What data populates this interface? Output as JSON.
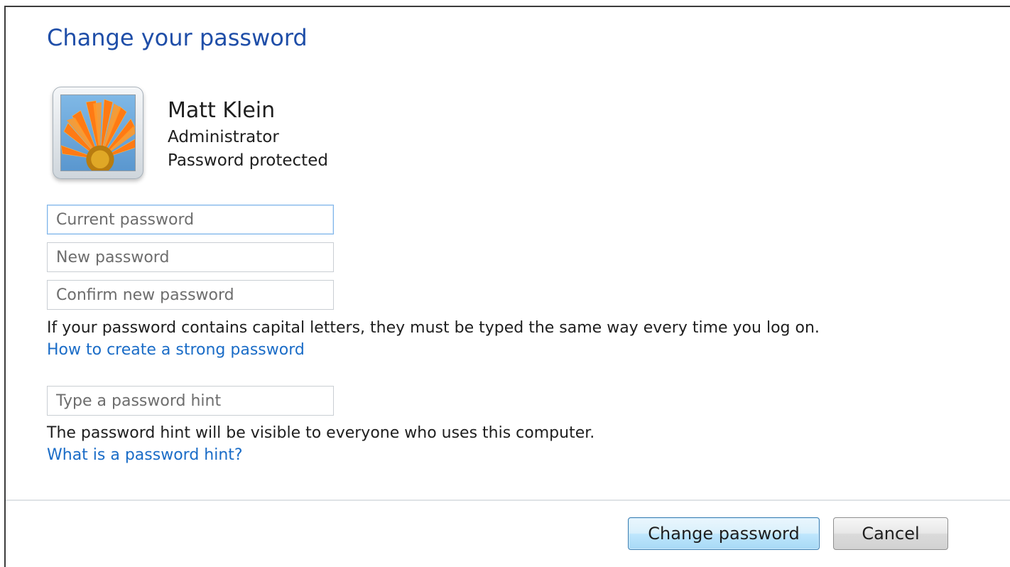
{
  "dialog": {
    "title": "Change your password"
  },
  "user": {
    "name": "Matt Klein",
    "role": "Administrator",
    "status": "Password protected",
    "avatar_icon": "flower-avatar-icon"
  },
  "fields": {
    "current_password_placeholder": "Current password",
    "new_password_placeholder": "New password",
    "confirm_password_placeholder": "Confirm new password",
    "hint_placeholder": "Type a password hint"
  },
  "notes": {
    "capitals_note": "If your password contains capital letters, they must be typed the same way every time you log on.",
    "strong_password_link": "How to create a strong password",
    "hint_visibility_note": "The password hint will be visible to everyone who uses this computer.",
    "hint_link": "What is a password hint?"
  },
  "buttons": {
    "change_label": "Change password",
    "cancel_label": "Cancel"
  },
  "colors": {
    "title": "#1f4ea8",
    "link": "#1a6cc7",
    "primary_button_border": "#3c7fb1"
  }
}
